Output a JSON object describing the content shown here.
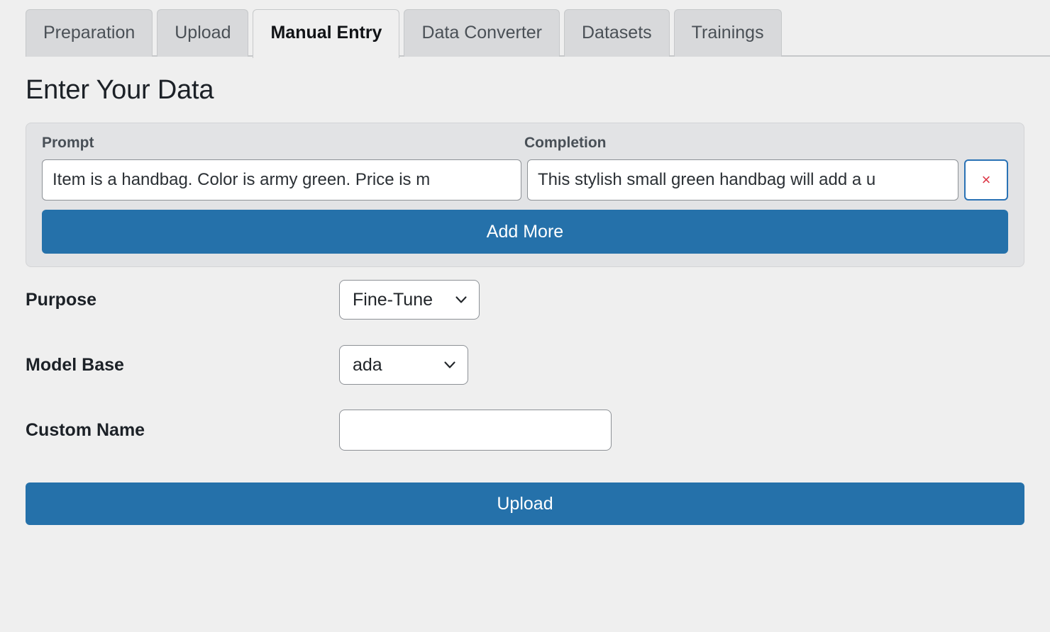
{
  "tabs": [
    {
      "label": "Preparation",
      "active": false
    },
    {
      "label": "Upload",
      "active": false
    },
    {
      "label": "Manual Entry",
      "active": true
    },
    {
      "label": "Data Converter",
      "active": false
    },
    {
      "label": "Datasets",
      "active": false
    },
    {
      "label": "Trainings",
      "active": false
    }
  ],
  "page": {
    "title": "Enter Your Data"
  },
  "entry_card": {
    "headers": {
      "prompt": "Prompt",
      "completion": "Completion"
    },
    "rows": [
      {
        "prompt_value": "Item is a handbag. Color is army green. Price is m",
        "prompt_placeholder": "",
        "completion_value": "This stylish small green handbag will add a u",
        "completion_placeholder": "",
        "delete_label": "×"
      }
    ],
    "add_more_label": "Add More"
  },
  "fields": {
    "purpose": {
      "label": "Purpose",
      "value": "Fine-Tune",
      "icon": "chevron-down-icon"
    },
    "model_base": {
      "label": "Model Base",
      "value": "ada",
      "icon": "chevron-down-icon"
    },
    "custom_name": {
      "label": "Custom Name",
      "value": "",
      "placeholder": ""
    }
  },
  "actions": {
    "upload_label": "Upload"
  },
  "colors": {
    "page_background": "#efefef",
    "card_background": "#e2e3e5",
    "primary": "#2571aa",
    "danger": "#dc3545",
    "tab_inactive": "#d8d9db",
    "border": "#c6c8ca"
  }
}
